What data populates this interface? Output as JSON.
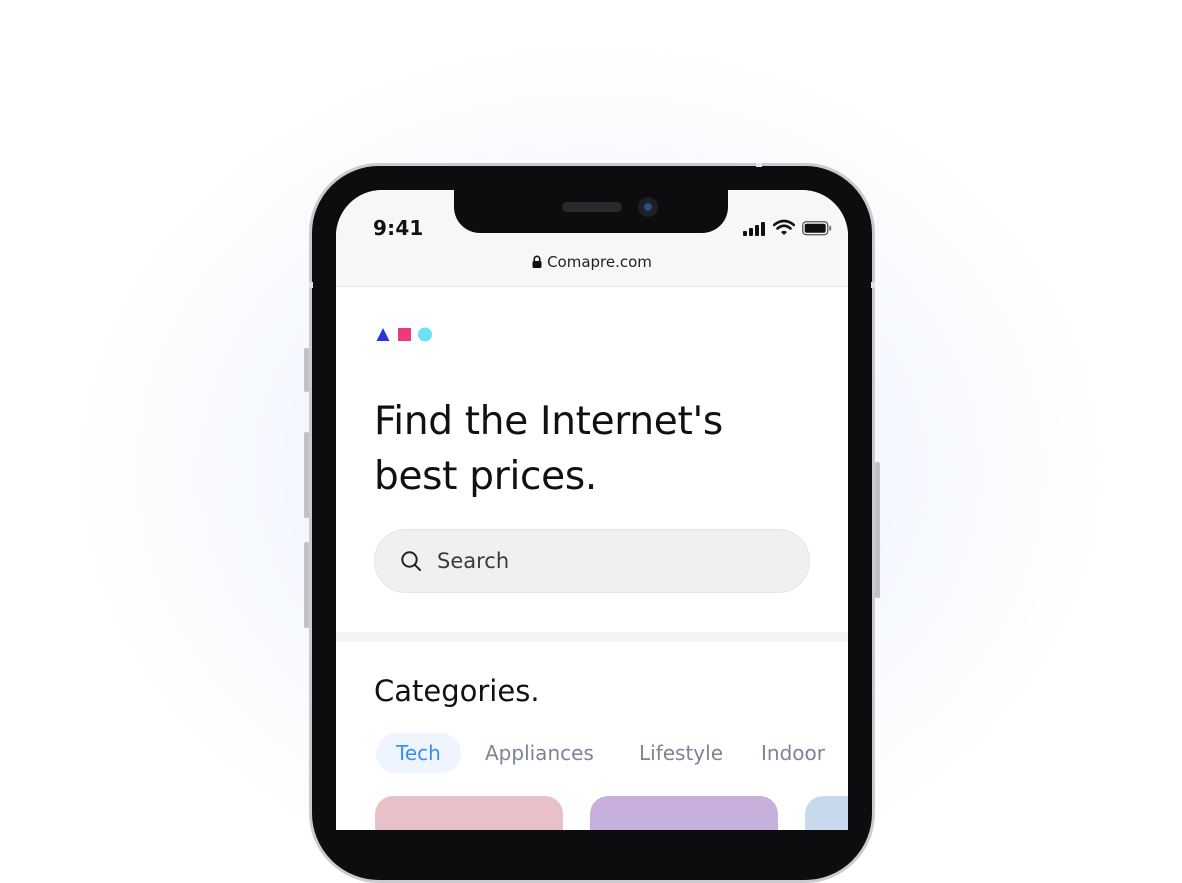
{
  "status_bar": {
    "time": "9:41"
  },
  "browser": {
    "url": "Comapre.com"
  },
  "logo": {
    "colors": [
      "#2b33d8",
      "#ee3a7a",
      "#6ee0f5"
    ]
  },
  "hero": {
    "headline_line1": "Find the Internet's",
    "headline_line2": "best prices."
  },
  "search": {
    "placeholder": "Search"
  },
  "categories": {
    "title": "Categories.",
    "tabs": [
      {
        "label": "Tech",
        "active": true
      },
      {
        "label": "Appliances",
        "active": false
      },
      {
        "label": "Lifestyle",
        "active": false
      },
      {
        "label": "Indoor",
        "active": false
      }
    ],
    "card_colors": [
      "#e8c1c8",
      "#c7b0dc",
      "#c8d9ee"
    ]
  },
  "accent_color": "#3b8ff0"
}
